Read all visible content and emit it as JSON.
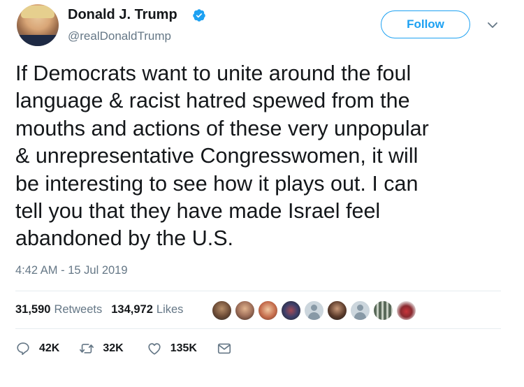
{
  "author": {
    "name": "Donald J. Trump",
    "handle": "@realDonaldTrump",
    "verified": true
  },
  "follow_button": {
    "label": "Follow"
  },
  "tweet": {
    "text": "If Democrats want to unite around the foul\nlanguage & racist hatred spewed from the\nmouths and actions of these very unpopular\n& unrepresentative Congresswomen, it will\nbe interesting to see how it plays out. I can\ntell you that they have made Israel feel\nabandoned by the U.S.",
    "timestamp": "4:42 AM - 15 Jul 2019"
  },
  "stats": {
    "retweets_count": "31,590",
    "retweets_label": "Retweets",
    "likes_count": "134,972",
    "likes_label": "Likes"
  },
  "actions": {
    "reply_count": "42K",
    "retweet_count": "32K",
    "like_count": "135K"
  },
  "colors": {
    "accent": "#1da1f2",
    "text": "#14171a",
    "muted": "#657786",
    "divider": "#e6ecf0"
  },
  "icons": [
    "verified-badge-icon",
    "chevron-down-icon",
    "reply-icon",
    "retweet-icon",
    "heart-icon",
    "direct-message-icon"
  ]
}
